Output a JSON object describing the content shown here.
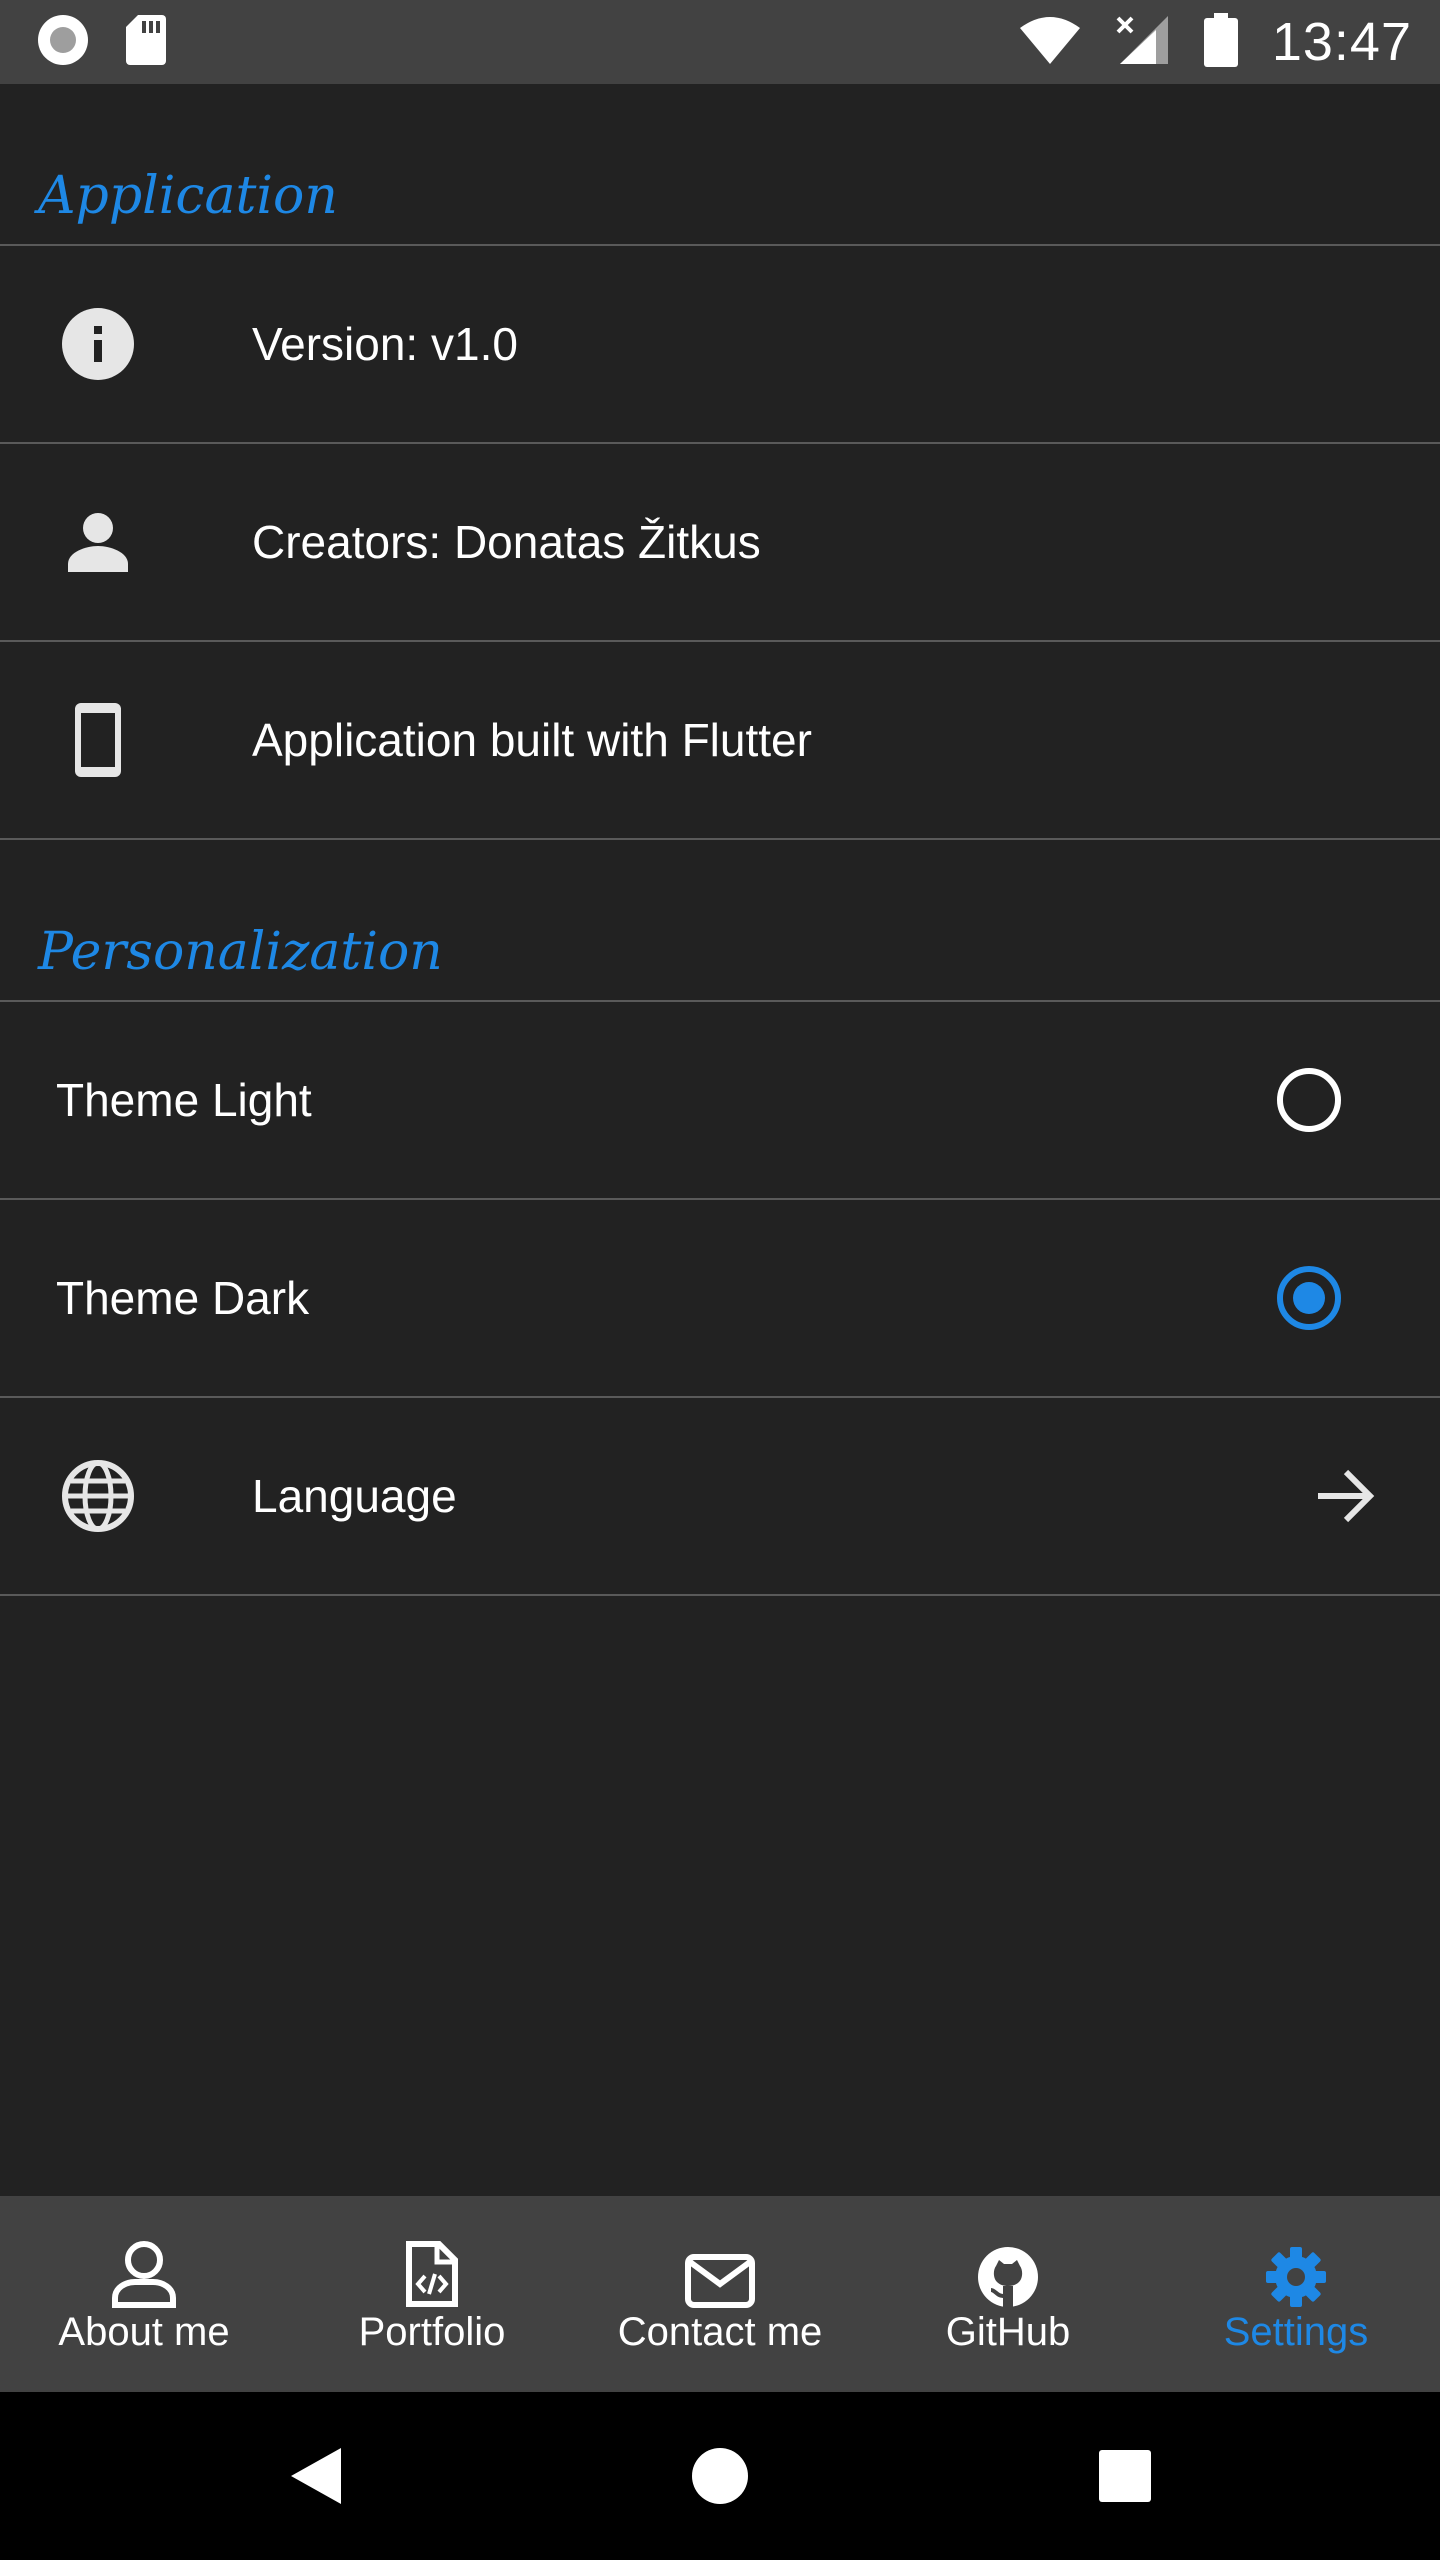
{
  "status_bar": {
    "time": "13:47",
    "icons": [
      "record-icon",
      "sd-card-icon",
      "wifi-icon",
      "signal-icon",
      "battery-icon"
    ]
  },
  "sections": {
    "application": {
      "title": "Application",
      "items": [
        {
          "icon": "info-icon",
          "label": "Version: v1.0"
        },
        {
          "icon": "person-icon",
          "label": "Creators: Donatas Žitkus"
        },
        {
          "icon": "phone-icon",
          "label": "Application built with Flutter"
        }
      ]
    },
    "personalization": {
      "title": "Personalization",
      "items": [
        {
          "label": "Theme Light",
          "selected": false
        },
        {
          "label": "Theme Dark",
          "selected": true
        },
        {
          "icon": "globe-icon",
          "label": "Language",
          "trailing": "arrow-right-icon"
        }
      ]
    }
  },
  "bottom_nav": {
    "items": [
      {
        "icon": "user-icon",
        "label": "About me",
        "active": false
      },
      {
        "icon": "code-file-icon",
        "label": "Portfolio",
        "active": false
      },
      {
        "icon": "envelope-icon",
        "label": "Contact me",
        "active": false
      },
      {
        "icon": "github-icon",
        "label": "GitHub",
        "active": false
      },
      {
        "icon": "gear-icon",
        "label": "Settings",
        "active": true
      }
    ]
  },
  "colors": {
    "accent": "#1e88e5",
    "background": "#222222",
    "bar": "#424242",
    "divider": "#5a5a5a"
  }
}
